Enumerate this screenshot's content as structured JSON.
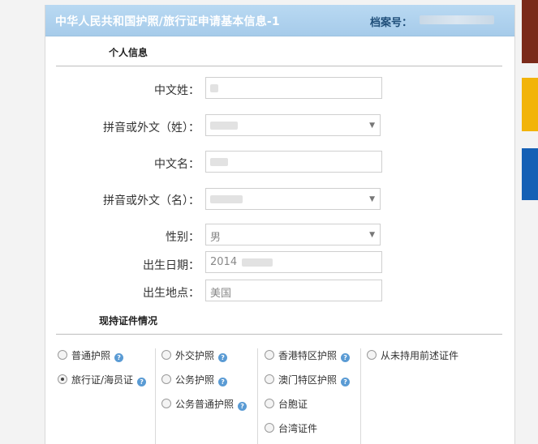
{
  "header": {
    "title": "中华人民共和国护照/旅行证申请基本信息-1",
    "archive_label": "档案号："
  },
  "sections": {
    "personal_info": "个人信息",
    "current_docs": "现持证件情况"
  },
  "fields": {
    "surname_cn": {
      "label": "中文姓：",
      "value": ""
    },
    "surname_py": {
      "label": "拼音或外文（姓）：",
      "value": ""
    },
    "given_cn": {
      "label": "中文名：",
      "value": ""
    },
    "given_py": {
      "label": "拼音或外文（名）：",
      "value": ""
    },
    "gender": {
      "label": "性别：",
      "value": "男"
    },
    "birth_date": {
      "label": "出生日期：",
      "value": "2014"
    },
    "birth_place": {
      "label": "出生地点：",
      "value": "美国"
    }
  },
  "documents": {
    "col1": [
      {
        "label": "普通护照",
        "help": "?",
        "checked": false
      },
      {
        "label": "旅行证/海员证",
        "help": "?",
        "checked": true
      }
    ],
    "col2": [
      {
        "label": "外交护照",
        "help": "?",
        "checked": false
      },
      {
        "label": "公务护照",
        "help": "?",
        "checked": false
      },
      {
        "label": "公务普通护照",
        "help": "?",
        "checked": false
      }
    ],
    "col3": [
      {
        "label": "香港特区护照",
        "help": "?",
        "checked": false
      },
      {
        "label": "澳门特区护照",
        "help": "?",
        "checked": false
      },
      {
        "label": "台胞证",
        "checked": false
      },
      {
        "label": "台湾证件",
        "checked": false
      }
    ],
    "col4": [
      {
        "label": "从未持用前述证件",
        "checked": false
      }
    ]
  },
  "side_thumbs": [
    {
      "color": "#7a2a1a"
    },
    {
      "color": "#f2b40a"
    },
    {
      "color": "#1560b5"
    }
  ]
}
